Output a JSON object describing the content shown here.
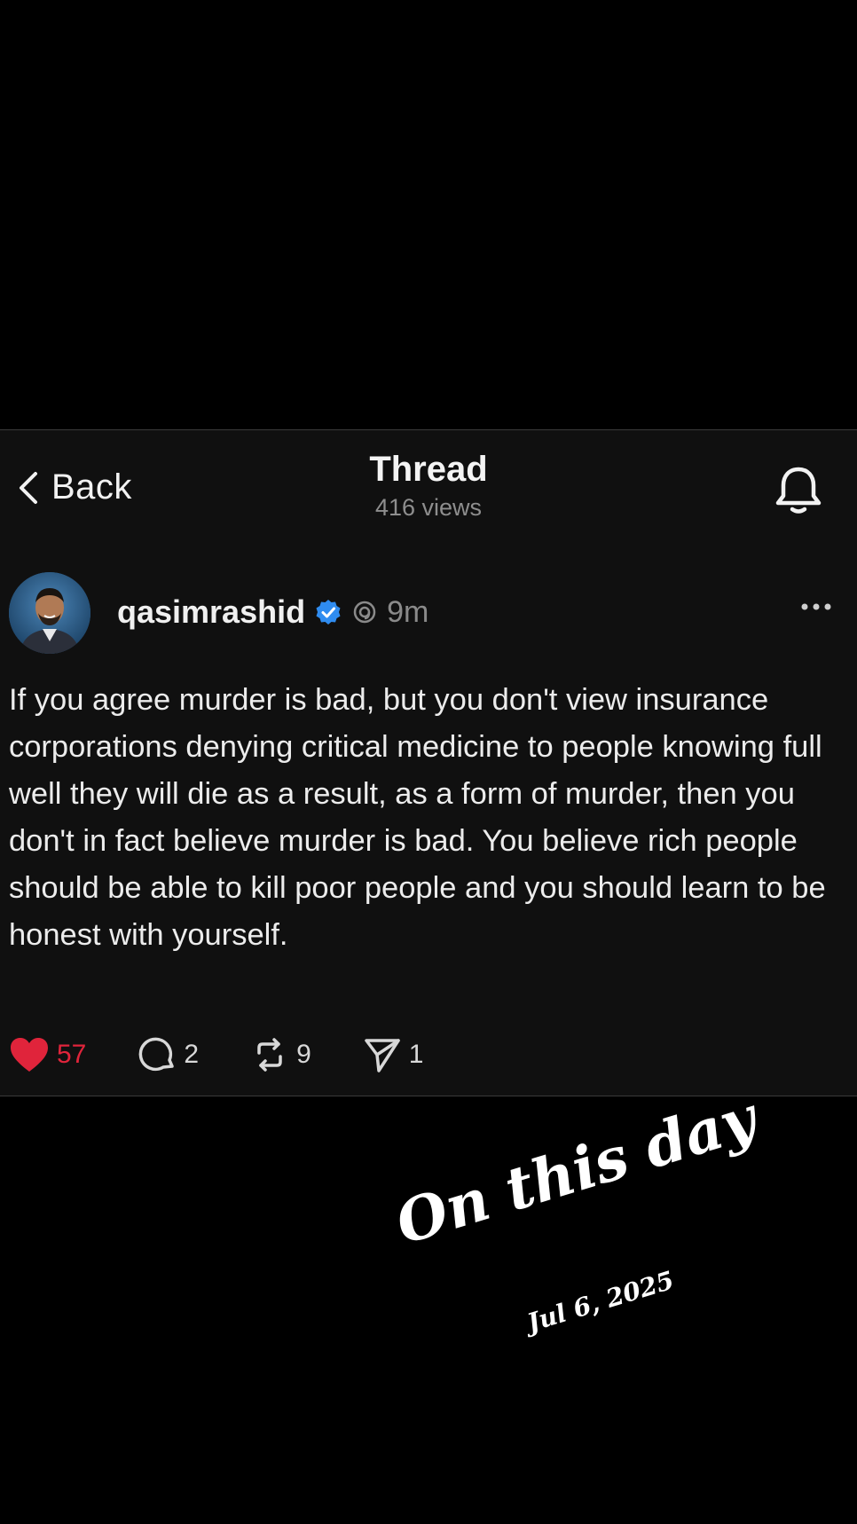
{
  "header": {
    "back_label": "Back",
    "title": "Thread",
    "views": "416 views"
  },
  "post": {
    "username": "qasimrashid",
    "time": "9m",
    "text": "If you agree murder is bad, but you don't view insurance corporations denying critical medicine to people knowing full well they will die as a result, as a form of murder, then you don't in fact believe murder is bad. You believe rich people should be able to kill poor people and you should learn to be honest with yourself.",
    "likes": "57",
    "replies": "2",
    "reposts": "9",
    "shares": "1"
  },
  "memory": {
    "title": "On this day",
    "date": "Jul 6, 2025"
  },
  "icons": {
    "back": "chevron-left-icon",
    "bell": "bell-icon",
    "verified": "verified-badge-icon",
    "thread": "threads-logo-icon",
    "more": "more-dots-icon",
    "like": "heart-icon",
    "reply": "comment-icon",
    "repost": "repost-icon",
    "share": "send-icon"
  },
  "colors": {
    "background": "#000000",
    "card": "#101010",
    "like_red": "#e0243b",
    "verified_blue": "#2f8cf0",
    "muted_text": "#8e8e8e"
  }
}
